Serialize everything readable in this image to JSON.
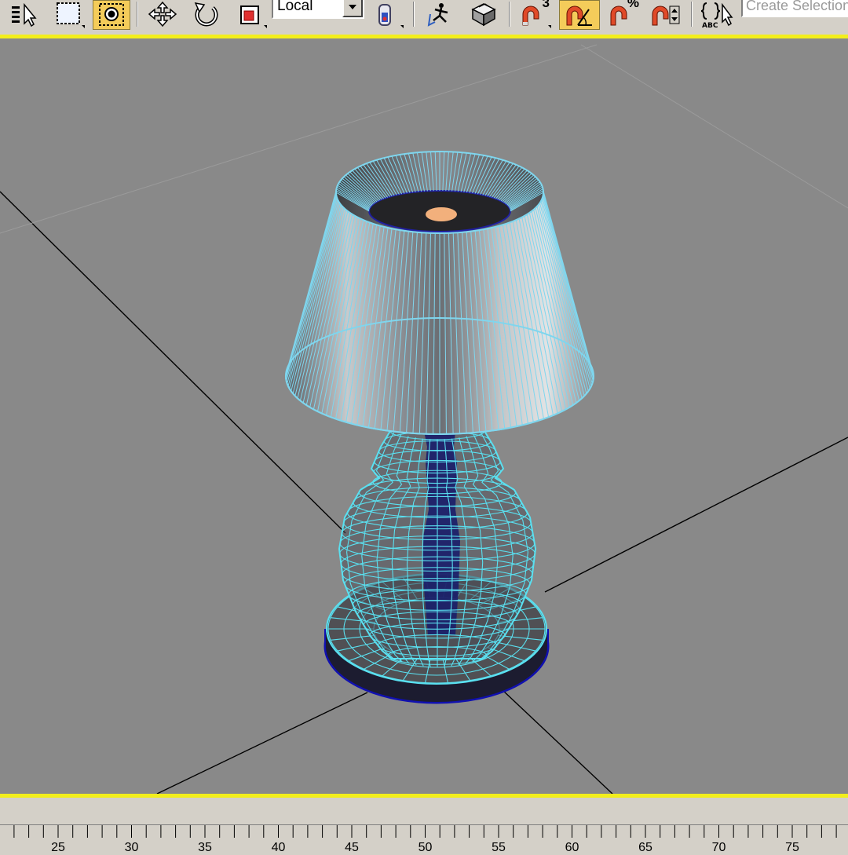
{
  "toolbar": {
    "coordinate_system": "Local",
    "snap_badge": "3",
    "percent_snap_badge": "%",
    "named_selection_placeholder": "Create Selection Set",
    "buttons": [
      {
        "name": "select-by-name-icon",
        "active": false
      },
      {
        "name": "rectangular-selection-icon",
        "active": false
      },
      {
        "name": "window-crossing-icon",
        "active": true
      },
      {
        "name": "move-icon",
        "active": false
      },
      {
        "name": "rotate-icon",
        "active": false
      },
      {
        "name": "scale-icon",
        "active": false
      },
      {
        "name": "use-pivot-center-icon",
        "active": false
      },
      {
        "name": "select-manipulate-icon",
        "active": false
      },
      {
        "name": "keyboard-shortcut-override-icon",
        "active": false
      },
      {
        "name": "snaps-toggle-icon",
        "active": false
      },
      {
        "name": "angle-snap-toggle-icon",
        "active": true
      },
      {
        "name": "percent-snap-toggle-icon",
        "active": false
      },
      {
        "name": "spinner-snap-toggle-icon",
        "active": false
      },
      {
        "name": "edit-named-selection-icon",
        "active": false
      }
    ],
    "accent_color": "#f4cc5a"
  },
  "viewport": {
    "background_color": "#898989",
    "active_border_color": "#f2ee1c",
    "wireframe_color": "#5ae0f0",
    "object": "table-lamp"
  },
  "timeline": {
    "ruler_labels": [
      "25",
      "30",
      "35",
      "40",
      "45",
      "50",
      "55",
      "60",
      "65",
      "70",
      "75"
    ]
  }
}
